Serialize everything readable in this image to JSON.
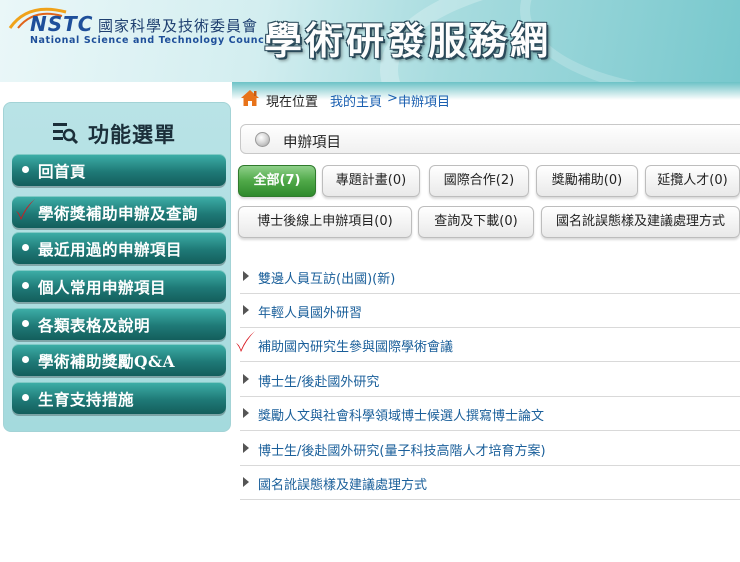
{
  "header": {
    "logo_mark": "NSTC",
    "logo_cn": "國家科學及技術委員會",
    "logo_en": "National Science and Technology Council",
    "site_title": "學術研發服務網"
  },
  "sidebar": {
    "heading": "功能選單",
    "items": [
      {
        "label": "回首頁",
        "checked": false
      },
      {
        "label": "學術獎補助申辦及查詢",
        "checked": true
      },
      {
        "label": "最近用過的申辦項目",
        "checked": false
      },
      {
        "label": "個人常用申辦項目",
        "checked": false
      },
      {
        "label": "各類表格及說明",
        "checked": false
      },
      {
        "label": "學術補助獎勵Q&A",
        "checked": false
      },
      {
        "label": "生育支持措施",
        "checked": false
      }
    ]
  },
  "breadcrumb": {
    "prefix": "現在位置",
    "home": "我的主頁",
    "separator": ">",
    "current": "申辦項目"
  },
  "section": {
    "title": "申辦項目"
  },
  "tabs": {
    "row1": [
      {
        "label": "全部(7)",
        "active": true
      },
      {
        "label": "專題計畫(0)",
        "active": false
      },
      {
        "label": "國際合作(2)",
        "active": false
      },
      {
        "label": "獎勵補助(0)",
        "active": false
      },
      {
        "label": "延攬人才(0)",
        "active": false
      }
    ],
    "row2": [
      {
        "label": "博士後線上申辦項目(0)",
        "active": false
      },
      {
        "label": "查詢及下載(0)",
        "active": false
      },
      {
        "label": "國名訛誤態樣及建議處理方式",
        "active": false
      }
    ]
  },
  "items": [
    {
      "label": "雙邊人員互訪(出國)(新)",
      "checked": false
    },
    {
      "label": "年輕人員國外研習",
      "checked": false
    },
    {
      "label": "補助國內研究生參與國際學術會議",
      "checked": true
    },
    {
      "label": "博士生/後赴國外研究",
      "checked": false
    },
    {
      "label": "獎勵人文與社會科學領域博士候選人撰寫博士論文",
      "checked": false
    },
    {
      "label": "博士生/後赴國外研究(量子科技高階人才培育方案)",
      "checked": false
    },
    {
      "label": "國名訛誤態樣及建議處理方式",
      "checked": false
    }
  ],
  "colors": {
    "sidebar_button": "#1f7a77",
    "active_tab": "#4fa848",
    "link": "#1a5fb0",
    "check_mark": "#d8141c"
  }
}
